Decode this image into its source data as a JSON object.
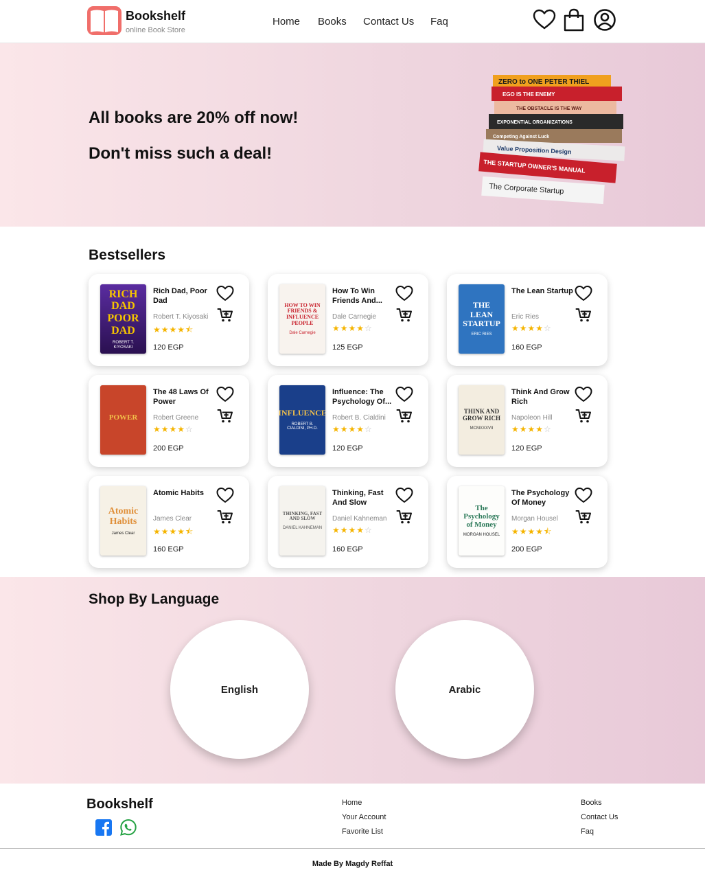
{
  "colors": {
    "accent": "#f06e6a",
    "star": "#f5b400",
    "hero_from": "#fbe6e9",
    "hero_to": "#e8c9d8"
  },
  "header": {
    "logo_icon": "open-book-icon",
    "brand": "Bookshelf",
    "tagline": "online Book Store",
    "nav": [
      "Home",
      "Books",
      "Contact Us",
      "Faq"
    ],
    "icons": [
      "heart-icon",
      "shopping-bag-icon",
      "user-icon"
    ]
  },
  "hero": {
    "line1": "All books are 20% off now!",
    "line2": "Don't miss such a deal!",
    "image": "book-stack-image",
    "spines": [
      "ZERO to ONE  PETER THIEL",
      "EGO IS THE ENEMY",
      "THE OBSTACLE IS THE WAY",
      "EXPONENTIAL ORGANIZATIONS",
      "Competing Against Luck",
      "Value Proposition Design",
      "THE STARTUP OWNER'S MANUAL",
      "The Corporate Startup"
    ]
  },
  "bestsellers": {
    "title": "Bestsellers",
    "books": [
      {
        "title": "Rich Dad, Poor Dad",
        "author": "Robert T. Kiyosaki",
        "stars": "★★★★⯪",
        "empty": "",
        "price": "120 EGP",
        "cover_text": "RICH DAD POOR DAD",
        "cover_sub": "ROBERT T. KIYOSAKI"
      },
      {
        "title": "How To Win Friends And...",
        "author": "Dale Carnegie",
        "stars": "★★★★",
        "empty": "☆",
        "price": "125 EGP",
        "cover_text": "HOW TO WIN FRIENDS & INFLUENCE PEOPLE",
        "cover_sub": "Dale Carnegie"
      },
      {
        "title": "The Lean Startup",
        "author": "Eric Ries",
        "stars": "★★★★",
        "empty": "☆",
        "price": "160 EGP",
        "cover_text": "THE LEAN STARTUP",
        "cover_sub": "ERIC RIES"
      },
      {
        "title": "The 48 Laws Of Power",
        "author": "Robert Greene",
        "stars": "★★★★",
        "empty": "☆",
        "price": "200 EGP",
        "cover_text": "POWER",
        "cover_sub": ""
      },
      {
        "title": "Influence: The Psychology Of...",
        "author": "Robert B. Cialdini",
        "stars": "★★★★",
        "empty": "☆",
        "price": "120 EGP",
        "cover_text": "INFLUENCE",
        "cover_sub": "ROBERT B. CIALDINI, PH.D."
      },
      {
        "title": "Think And Grow Rich",
        "author": "Napoleon Hill",
        "stars": "★★★★",
        "empty": "☆",
        "price": "120 EGP",
        "cover_text": "THINK AND GROW RICH",
        "cover_sub": "MCMXXXVII"
      },
      {
        "title": "Atomic Habits",
        "author": "James Clear",
        "stars": "★★★★⯪",
        "empty": "",
        "price": "160 EGP",
        "cover_text": "Atomic Habits",
        "cover_sub": "James Clear"
      },
      {
        "title": "Thinking, Fast And Slow",
        "author": "Daniel Kahneman",
        "stars": "★★★★",
        "empty": "☆",
        "price": "160 EGP",
        "cover_text": "THINKING, FAST AND SLOW",
        "cover_sub": "DANIEL KAHNEMAN"
      },
      {
        "title": "The Psychology Of Money",
        "author": "Morgan Housel",
        "stars": "★★★★⯪",
        "empty": "",
        "price": "200 EGP",
        "cover_text": "The Psychology of Money",
        "cover_sub": "MORGAN HOUSEL"
      }
    ]
  },
  "languages": {
    "title": "Shop By Language",
    "options": [
      "English",
      "Arabic"
    ]
  },
  "footer": {
    "brand": "Bookshelf",
    "social": [
      "facebook-icon",
      "whatsapp-icon"
    ],
    "links_col1": [
      "Home",
      "Your Account",
      "Favorite List"
    ],
    "links_col2": [
      "Books",
      "Contact Us",
      "Faq"
    ],
    "credit": "Made By Magdy Reffat"
  }
}
